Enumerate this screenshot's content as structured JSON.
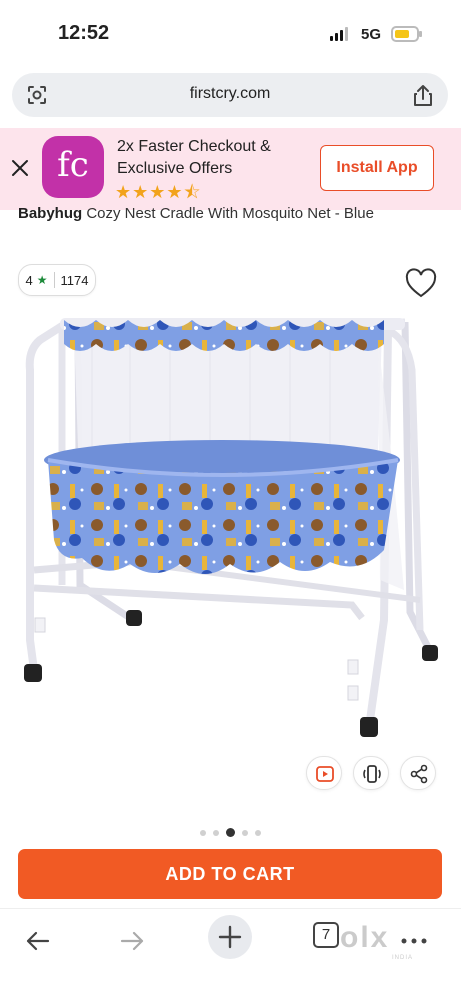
{
  "status": {
    "time": "12:52",
    "network": "5G"
  },
  "browser": {
    "url": "firstcry.com",
    "tab_count": "7"
  },
  "banner": {
    "logo_text": "fc",
    "line1": "2x Faster Checkout &",
    "line2": "Exclusive Offers",
    "stars": "★★★★⯪",
    "install_label": "Install App"
  },
  "product": {
    "brand": "Babyhug",
    "name": " Cozy Nest Cradle With Mosquito Net - Blue",
    "rating": "4",
    "reviews": "1174"
  },
  "cart": {
    "label": "ADD TO CART"
  },
  "watermark": {
    "text": "olx",
    "sub": "INDIA"
  },
  "colors": {
    "accent": "#f15a24",
    "banner_bg": "#fde4ec",
    "brand": "#c231a8",
    "rating_star": "#1c8a3a"
  },
  "icons": [
    "lens-icon",
    "share-icon",
    "close-icon",
    "heart-icon",
    "video-icon",
    "rotate-icon",
    "share-nodes-icon",
    "back-icon",
    "forward-icon",
    "plus-icon",
    "more-icon"
  ]
}
